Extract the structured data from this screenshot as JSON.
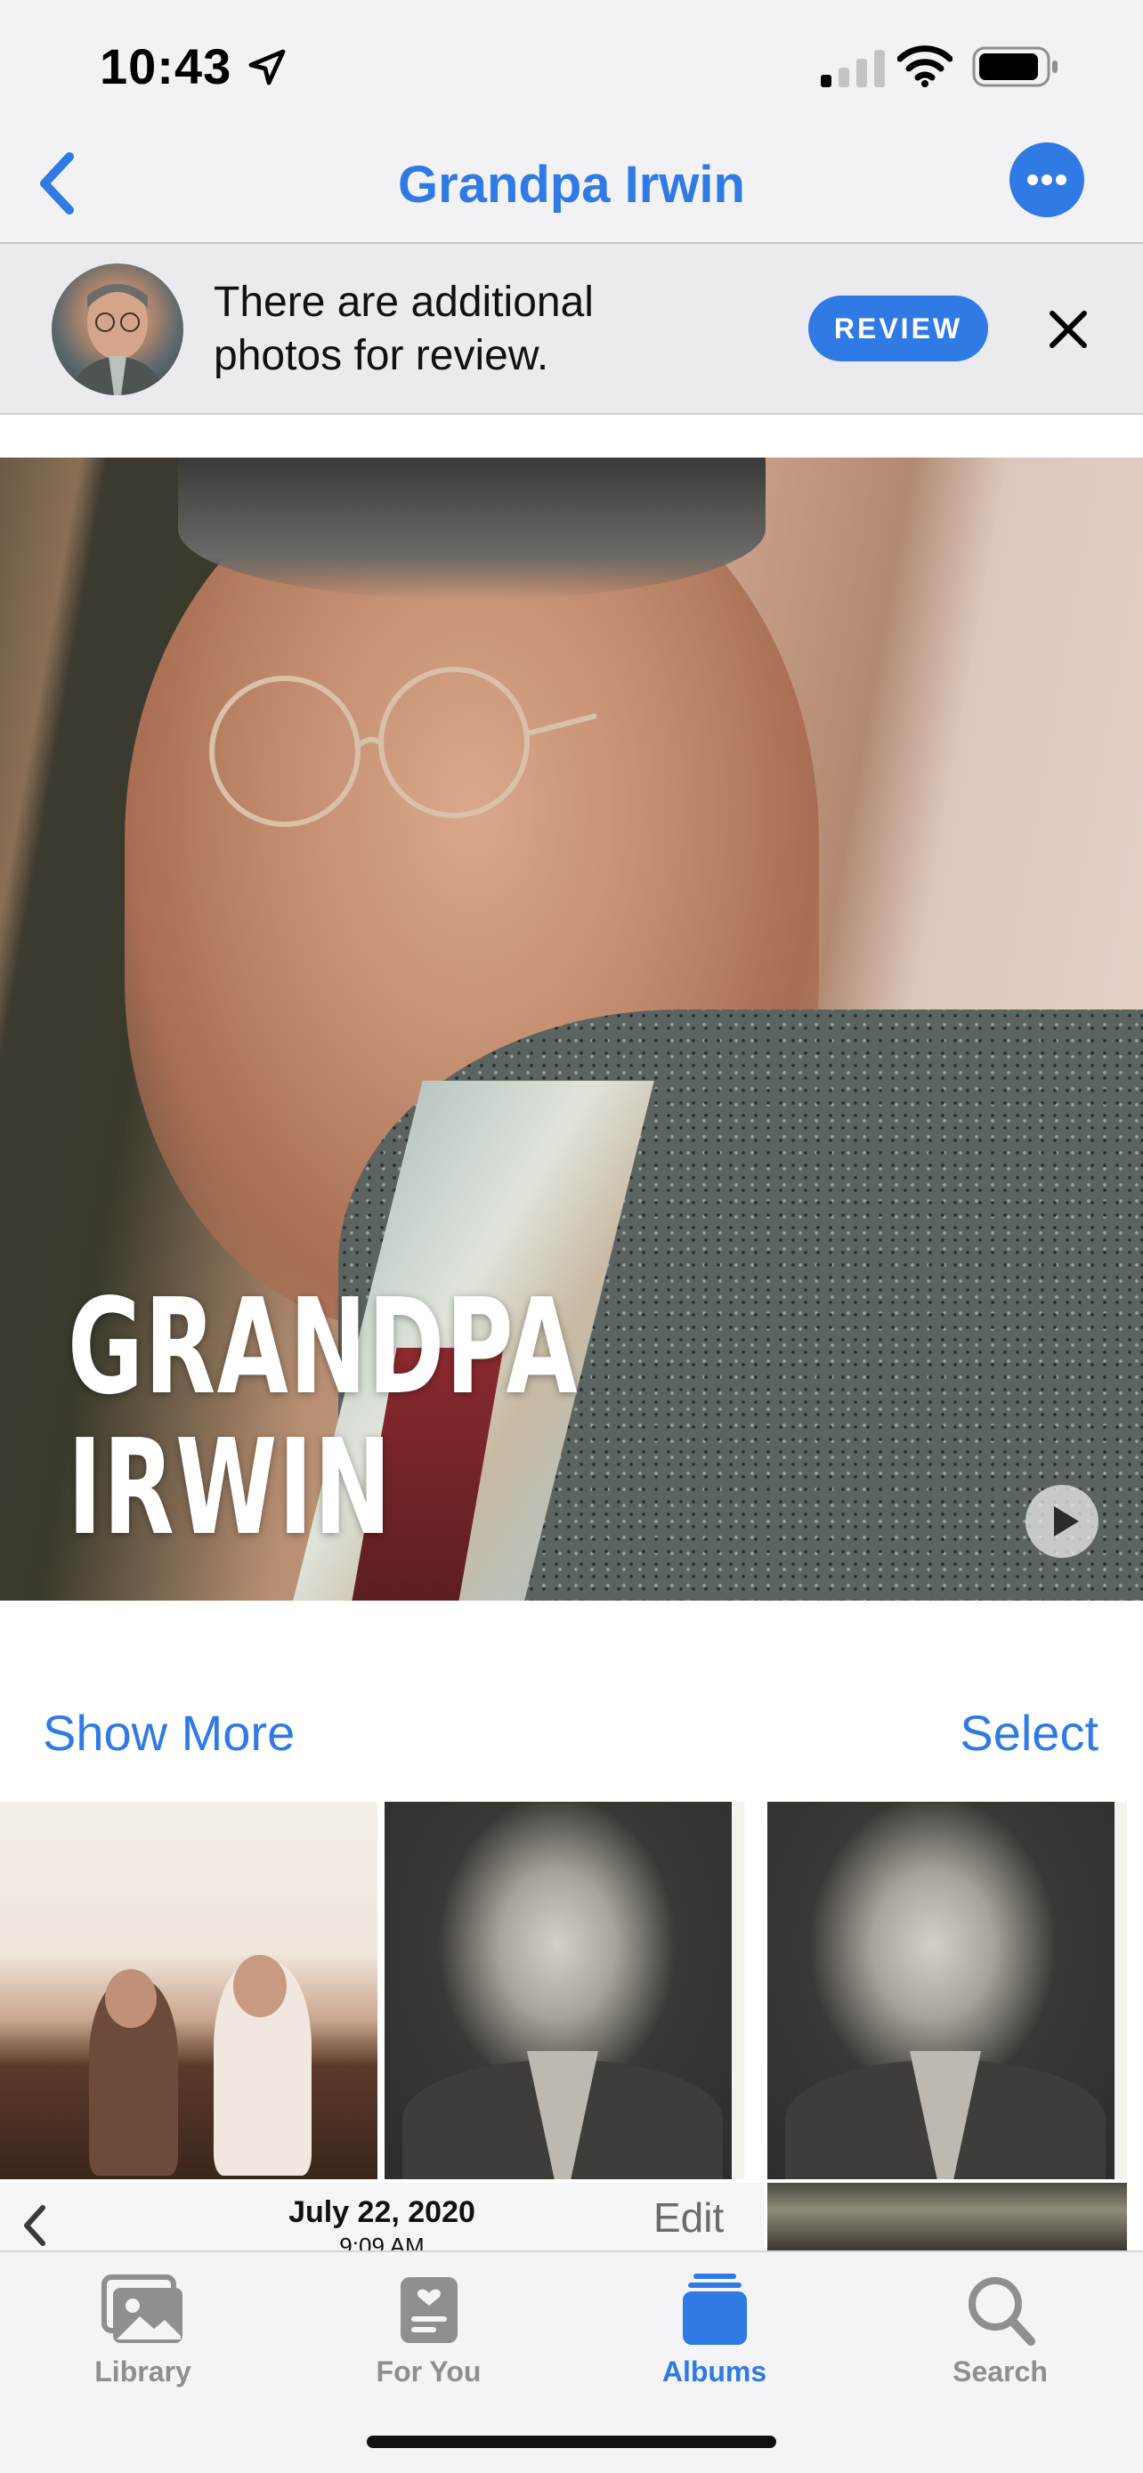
{
  "status_bar": {
    "time": "10:43",
    "icons": [
      "location-arrow-icon",
      "cellular-signal-icon",
      "wifi-icon",
      "battery-icon"
    ]
  },
  "nav": {
    "title": "Grandpa Irwin",
    "back_icon": "chevron-left-icon",
    "more_icon": "ellipsis-icon"
  },
  "review_banner": {
    "text": "There are additional photos for review.",
    "button_label": "REVIEW",
    "close_icon": "close-icon"
  },
  "key_photo": {
    "title_line1": "GRANDPA",
    "title_line2": "IRWIN",
    "play_icon": "play-icon"
  },
  "section": {
    "show_more": "Show More",
    "select": "Select"
  },
  "edit_bar": {
    "date": "July 22, 2020",
    "time": "9:09 AM",
    "edit_label": "Edit"
  },
  "tab_bar": {
    "tabs": [
      {
        "label": "Library",
        "icon": "photo-library-icon",
        "active": false
      },
      {
        "label": "For You",
        "icon": "for-you-icon",
        "active": false
      },
      {
        "label": "Albums",
        "icon": "albums-icon",
        "active": true
      },
      {
        "label": "Search",
        "icon": "search-icon",
        "active": false
      }
    ]
  },
  "colors": {
    "accent": "#2f7ae5",
    "inactive": "#8e8e93",
    "background": "#f2f2f4"
  }
}
